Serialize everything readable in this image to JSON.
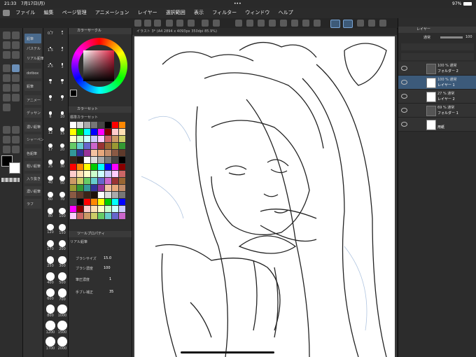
{
  "status": {
    "time": "21:33",
    "date": "7月17日(月)",
    "dots": "•••",
    "battery": "97%"
  },
  "menu": [
    "ファイル",
    "編集",
    "ページ管理",
    "アニメーション",
    "レイヤー",
    "選択範囲",
    "表示",
    "フィルター",
    "ウィンドウ",
    "ヘルプ"
  ],
  "document_tab": "イラスト 3* (A4 2894 x 4093px 350dpi 85.9%)",
  "subtools": {
    "items": [
      "鉛筆",
      "パステル",
      "リアル鉛筆",
      "dotbox",
      "鉛筆",
      "アニメ一",
      "デッサン",
      "濃い鉛筆",
      "シャーペン",
      "色鉛筆",
      "粗い鉛筆",
      "入り抜き",
      "濃い鉛筆",
      "ラフ"
    ]
  },
  "brush_sizes": [
    "0.7",
    "1",
    "1.5",
    "2",
    "2.5",
    "3",
    "4",
    "5",
    "6",
    "7",
    "8",
    "10",
    "12",
    "15",
    "17",
    "20",
    "25",
    "30",
    "40",
    "50",
    "60",
    "70",
    "80",
    "100",
    "120",
    "150",
    "170",
    "200",
    "250",
    "300",
    "400",
    "500",
    "600",
    "700",
    "800",
    "1000",
    "1200",
    "1500",
    "1700",
    "2000"
  ],
  "color_panel": {
    "circle_title": "カラーサークル",
    "set_title": "カラーセット",
    "set_name": "標準カラーセット",
    "tool_property_title": "ツールプロパティ",
    "tool_name": "リアル鉛筆"
  },
  "tool_property": {
    "brush_size_label": "ブラシサイズ",
    "brush_size_value": "15.0",
    "brush_density_label": "ブラシ濃度",
    "brush_density_value": "100",
    "pressure_label": "筆圧濃度",
    "pressure_value": "1",
    "correction_label": "手ブレ補正",
    "correction_value": "35"
  },
  "layers_panel": {
    "title": "レイヤー",
    "blend_mode": "通常",
    "opacity": "100",
    "layers": [
      {
        "line1": "100 % 通常",
        "line2": "フォルダー 2"
      },
      {
        "line1": "100 % 通常",
        "line2": "レイヤー 1"
      },
      {
        "line1": "27 % 通常",
        "line2": "レイヤー 2"
      },
      {
        "line1": "69 % 通常",
        "line2": "フォルダー 1"
      },
      {
        "line1": "",
        "line2": "用紙"
      }
    ]
  },
  "colors": {
    "accent": "#3c5a7a",
    "main_color": "#000000",
    "sub_color": "#ffffff"
  }
}
